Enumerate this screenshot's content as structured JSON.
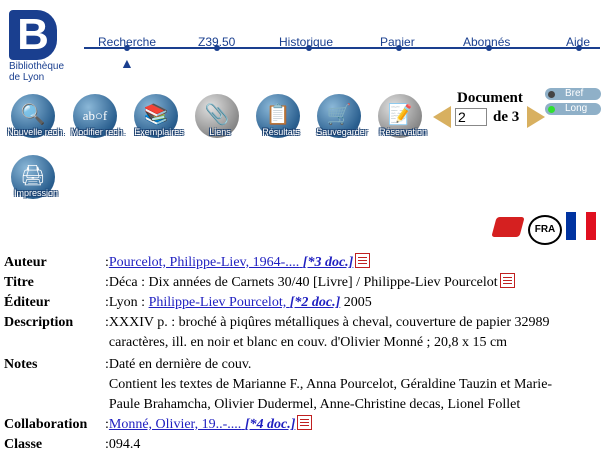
{
  "logo": {
    "letter": "B",
    "line1": "Bibliothèque",
    "line2": "de Lyon"
  },
  "nav": [
    "Recherche",
    "Z39.50",
    "Historique",
    "Panier",
    "Abonnés",
    "Aide"
  ],
  "toolbar": {
    "new_search": "Nouvelle rech.",
    "modify_search": "Modifier rech.",
    "copies": "Exemplaires",
    "links": "Liens",
    "results": "Résultats",
    "save": "Sauvegarder",
    "reservation": "Réservation",
    "print": "Impression"
  },
  "document": {
    "title": "Document",
    "current": "2",
    "of_label": "de 3"
  },
  "format": {
    "brief": "Bref",
    "long": "Long"
  },
  "lang": {
    "fra": "FRA"
  },
  "colors": {
    "brand": "#1a3f8f",
    "link": "#2020c0"
  },
  "record": {
    "author_label": "Auteur",
    "author_name": "Pourcelot, Philippe-Liev, 1964-....",
    "author_docs": "[*3 doc.]",
    "title_label": "Titre",
    "title_value": "Déca : Dix années de Carnets 30/40 [Livre] / Philippe-Liev Pourcelot",
    "publisher_label": "Éditeur",
    "publisher_place": "Lyon : ",
    "publisher_name": "Philippe-Liev Pourcelot,",
    "publisher_docs": "[*2 doc.]",
    "publisher_year": " 2005",
    "description_label": "Description",
    "description_value": "XXXIV p. : broché à piqûres métalliques à cheval, couverture de papier 32989 caractères, ill. en noir et blanc en couv. d'Olivier Monné ; 20,8 x 15 cm",
    "notes_label": "Notes",
    "notes_line1": "Daté en dernière de couv.",
    "notes_line2": "Contient les textes de Marianne F., Anna Pourcelot, Géraldine Tauzin et Marie-Paule Brahamcha, Olivier Dudermel, Anne-Christine decas, Lionel Follet",
    "collab_label": "Collaboration",
    "collab_name": "Monné, Olivier, 19..-....",
    "collab_docs": "[*4 doc.]",
    "class_label": "Classe",
    "class_value": "094.4"
  }
}
